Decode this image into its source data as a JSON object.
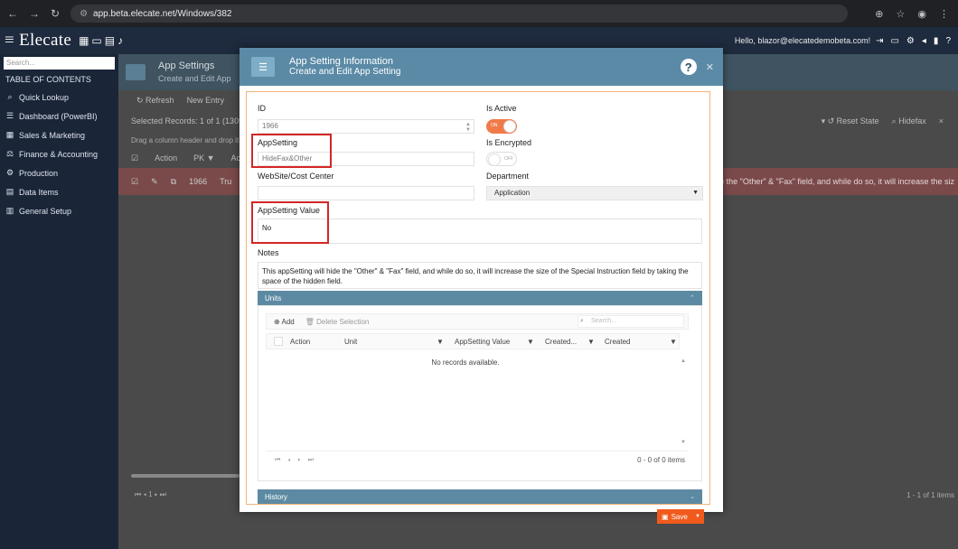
{
  "browser": {
    "url": "app.beta.elecate.net/Windows/382"
  },
  "app": {
    "logo": "Elecate",
    "greeting": "Hello, blazor@elecatedemobeta.com!"
  },
  "sidebar": {
    "search_placeholder": "Search...",
    "toc": "TABLE OF CONTENTS",
    "items": [
      {
        "label": "Quick Lookup",
        "icon": "search-icon"
      },
      {
        "label": "Dashboard (PowerBI)",
        "icon": "menu-icon"
      },
      {
        "label": "Sales & Marketing",
        "icon": "chart-icon"
      },
      {
        "label": "Finance & Accounting",
        "icon": "scale-icon"
      },
      {
        "label": "Production",
        "icon": "cogs-icon"
      },
      {
        "label": "Data Items",
        "icon": "grid-icon"
      },
      {
        "label": "General Setup",
        "icon": "bank-icon"
      }
    ]
  },
  "page": {
    "title": "App Settings",
    "subtitle": "Create and Edit App",
    "refresh": "Refresh",
    "new_entry": "New Entry",
    "selected": "Selected Records: 1 of 1 (1309",
    "reset_state": "Reset State",
    "search_value": "Hidefax",
    "drag_hint": "Drag a column header and drop it",
    "col_action": "Action",
    "col_pk": "PK",
    "col_ac": "Ac",
    "row_id": "1966",
    "row_tru": "Tru",
    "row_long": "will hide the \"Other\" & \"Fax\" field, and while do so, it will increase the siz",
    "page_num": "1",
    "page_count": "1 - 1 of 1 items"
  },
  "modal": {
    "title": "App Setting Information",
    "subtitle": "Create and Edit App Setting",
    "id_label": "ID",
    "id_value": "1966",
    "is_active_label": "Is Active",
    "toggle_on": "ON",
    "appsetting_label": "AppSetting",
    "appsetting_value": "HideFax&Other",
    "is_encrypted_label": "Is Encrypted",
    "toggle_off": "OFF",
    "website_label": "WebSite/Cost Center",
    "website_value": "",
    "department_label": "Department",
    "department_value": "Application",
    "appsetting_value_label": "AppSetting Value",
    "appsetting_value_value": "No",
    "notes_label": "Notes",
    "notes_value": "This appSetting will hide the \"Other\" & \"Fax\" field, and while do so, it will increase the size of the Special Instruction field by taking the space of the hidden field.",
    "units_title": "Units",
    "add_label": "Add",
    "delete_label": "Delete Selection",
    "search_placeholder": "Search...",
    "columns": [
      "Action",
      "Unit",
      "AppSetting Value",
      "Created...",
      "Created"
    ],
    "empty": "No records available.",
    "pager_count": "0 - 0 of 0 items",
    "history_title": "History",
    "save_label": "Save"
  }
}
